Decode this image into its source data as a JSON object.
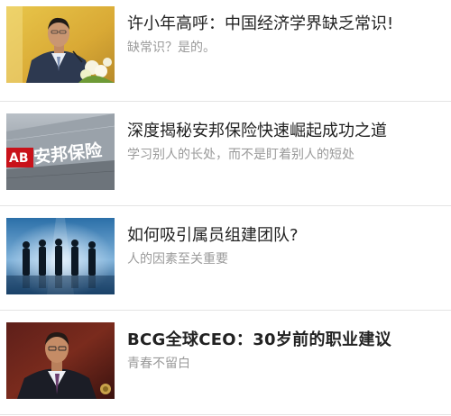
{
  "articles": [
    {
      "title": "许小年高呼：中国经济学界缺乏常识!",
      "subtitle": "缺常识？是的。",
      "thumbnail_icon": "speaker-at-podium-photo"
    },
    {
      "title": "深度揭秘安邦保险快速崛起成功之道",
      "subtitle": "学习别人的长处，而不是盯着别人的短处",
      "thumbnail_icon": "anbang-insurance-sign-photo",
      "thumbnail_text": "安邦保险",
      "thumbnail_logo": "AB"
    },
    {
      "title": "如何吸引属员组建团队?",
      "subtitle": "人的因素至关重要",
      "thumbnail_icon": "team-silhouettes-photo"
    },
    {
      "title": "BCG全球CEO：30岁前的职业建议",
      "subtitle": "青春不留白",
      "thumbnail_icon": "executive-portrait-photo"
    }
  ],
  "colors": {
    "title": "#222222",
    "subtitle": "#9a9a9a",
    "separator": "#e4e4e4",
    "anbang_red": "#c9121a"
  }
}
